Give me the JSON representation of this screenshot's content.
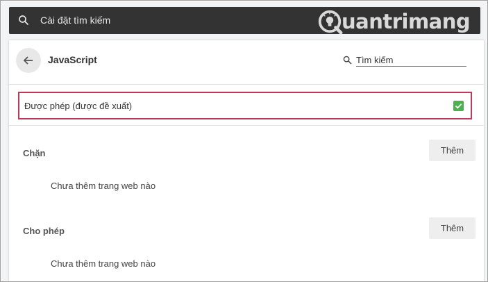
{
  "search_bar": {
    "placeholder": "Cài đặt tìm kiếm",
    "icon": "search-icon"
  },
  "watermark": {
    "text": "uantrimang",
    "mark_letter": "Q"
  },
  "header": {
    "title": "JavaScript",
    "search_placeholder": "Tìm kiếm"
  },
  "allowed_toggle": {
    "label": "Được phép (được đề xuất)",
    "checked": true,
    "color": "#4caf50",
    "highlight_color": "#c0395a"
  },
  "blocked_section": {
    "title": "Chặn",
    "add_label": "Thêm",
    "empty_text": "Chưa thêm trang web nào"
  },
  "allow_section": {
    "title": "Cho phép",
    "add_label": "Thêm",
    "empty_text": "Chưa thêm trang web nào"
  }
}
